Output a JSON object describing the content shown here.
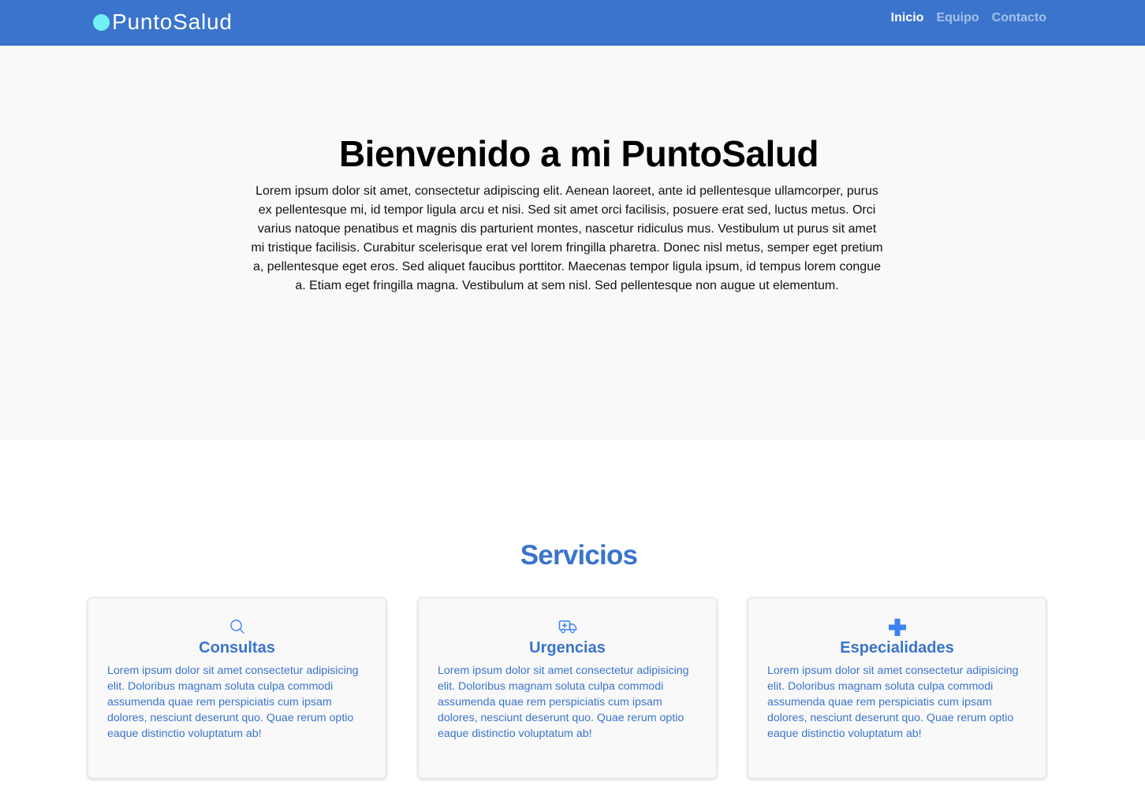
{
  "navbar": {
    "brand": "PuntoSalud",
    "links": [
      {
        "label": "Inicio",
        "active": true
      },
      {
        "label": "Equipo",
        "active": false
      },
      {
        "label": "Contacto",
        "active": false
      }
    ]
  },
  "hero": {
    "title": "Bienvenido a mi PuntoSalud",
    "text": "Lorem ipsum dolor sit amet, consectetur adipiscing elit. Aenean laoreet, ante id pellentesque ullamcorper, purus ex pellentesque mi, id tempor ligula arcu et nisi. Sed sit amet orci facilisis, posuere erat sed, luctus metus. Orci varius natoque penatibus et magnis dis parturient montes, nascetur ridiculus mus. Vestibulum ut purus sit amet mi tristique facilisis. Curabitur scelerisque erat vel lorem fringilla pharetra. Donec nisl metus, semper eget pretium a, pellentesque eget eros. Sed aliquet faucibus porttitor. Maecenas tempor ligula ipsum, id tempus lorem congue a. Etiam eget fringilla magna. Vestibulum at sem nisl. Sed pellentesque non augue ut elementum."
  },
  "services": {
    "title": "Servicios",
    "cards": [
      {
        "icon": "search-icon",
        "title": "Consultas",
        "text": "Lorem ipsum dolor sit amet consectetur adipisicing elit. Doloribus magnam soluta culpa commodi assumenda quae rem perspiciatis cum ipsam dolores, nesciunt deserunt quo. Quae rerum optio eaque distinctio voluptatum ab!"
      },
      {
        "icon": "ambulance-icon",
        "title": "Urgencias",
        "text": "Lorem ipsum dolor sit amet consectetur adipisicing elit. Doloribus magnam soluta culpa commodi assumenda quae rem perspiciatis cum ipsam dolores, nesciunt deserunt quo. Quae rerum optio eaque distinctio voluptatum ab!"
      },
      {
        "icon": "plus-icon",
        "title": "Especialidades",
        "text": "Lorem ipsum dolor sit amet consectetur adipisicing elit. Doloribus magnam soluta culpa commodi assumenda quae rem perspiciatis cum ipsam dolores, nesciunt deserunt quo. Quae rerum optio eaque distinctio voluptatum ab!"
      }
    ]
  },
  "colors": {
    "primary": "#3a74cc",
    "logo_dot": "#6ff1f5",
    "hero_bg": "#f9f9f9",
    "icon_blue": "#3b82f6"
  }
}
